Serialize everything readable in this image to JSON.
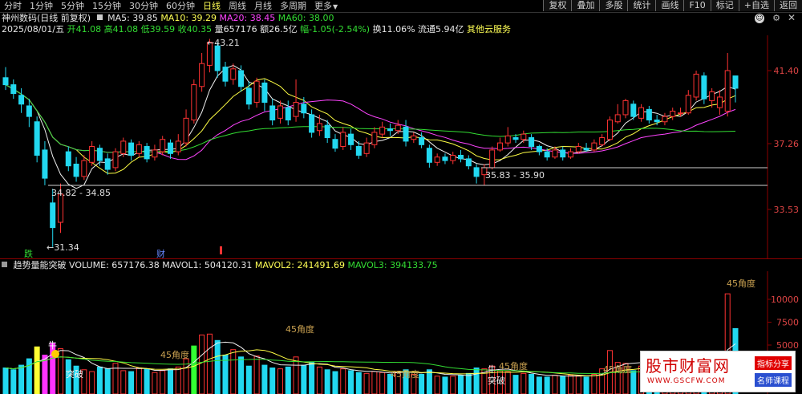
{
  "toolbar": {
    "periods": [
      "分时",
      "1分钟",
      "5分钟",
      "15分钟",
      "30分钟",
      "60分钟",
      "日线",
      "周线",
      "月线",
      "多周期",
      "更多"
    ],
    "active_period": "日线",
    "tools": [
      "复权",
      "叠加",
      "多股",
      "统计",
      "画线",
      "F10",
      "标记",
      "+自选",
      "返回"
    ]
  },
  "header": {
    "stock": "神州数码(日线 前复权)",
    "ma5": "MA5: 39.85",
    "ma10": "MA10: 39.29",
    "ma20": "MA20: 38.45",
    "ma60": "MA60: 38.00",
    "date": "2025/08/01/五",
    "open": "开41.08",
    "high": "高41.08",
    "low": "低39.59",
    "close": "收40.35",
    "volume": "量657176",
    "amount": "额26.5亿",
    "change": "幅-1.05(-2.54%)",
    "turnover": "换11.06%",
    "float": "流通5.94亿",
    "services": "其他云服务"
  },
  "volume_header": {
    "indicator": "趋势量能突破",
    "volume": "VOLUME: 657176.38",
    "mavol1": "MAVOL1: 504120.31",
    "mavol2": "MAVOL2: 241491.69",
    "mavol3": "MAVOL3: 394133.75"
  },
  "price_axis": [
    "41.40",
    "37.26",
    "33.53"
  ],
  "volume_axis": [
    "10000",
    "7500",
    "5000"
  ],
  "annotations": {
    "high_label": "43.21",
    "low_label": "31.34",
    "range1": "34.82 - 34.85",
    "range2": "35.83 - 35.90",
    "event_die": "跌",
    "event_cai": "财",
    "angle45": "45角度",
    "niu": "牛",
    "tupo": "突破"
  },
  "watermark": {
    "title": "股市财富网",
    "url": "WWW.GSCFW.COM",
    "tag1": "指标分享",
    "tag2": "名师课程"
  },
  "colors": {
    "up": "#ff3333",
    "down": "#22d8f0",
    "ma5": "#f0f0f0",
    "ma10": "#ffff44",
    "ma20": "#ff44ff",
    "ma60": "#33dd33"
  }
}
